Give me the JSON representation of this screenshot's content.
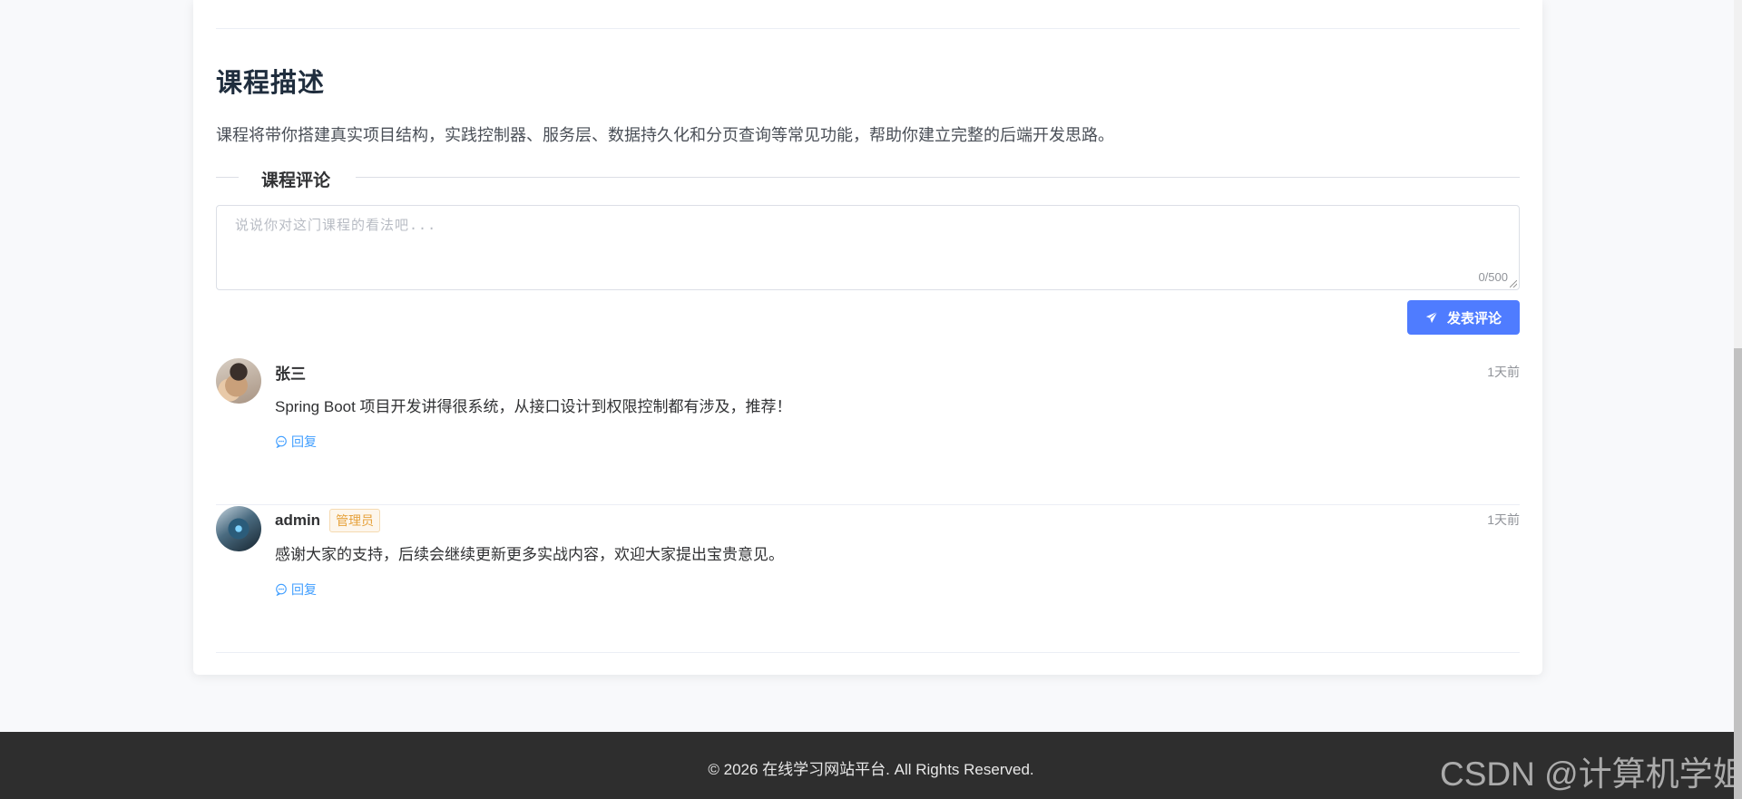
{
  "course": {
    "description_title": "课程描述",
    "description_text": "课程将带你搭建真实项目结构，实践控制器、服务层、数据持久化和分页查询等常见功能，帮助你建立完整的后端开发思路。"
  },
  "comments_section": {
    "title": "课程评论",
    "input_placeholder": "说说你对这门课程的看法吧...",
    "input_value": "",
    "char_count": "0/500",
    "submit_label": "发表评论",
    "submit_icon": "paper-plane-icon"
  },
  "comments": [
    {
      "author": "张三",
      "badge": "",
      "time": "1天前",
      "content": "Spring Boot 项目开发讲得很系统，从接口设计到权限控制都有涉及，推荐！",
      "reply_label": "回复"
    },
    {
      "author": "admin",
      "badge": "管理员",
      "time": "1天前",
      "content": "感谢大家的支持，后续会继续更新更多实战内容，欢迎大家提出宝贵意见。",
      "reply_label": "回复"
    }
  ],
  "footer": {
    "copyright": "© 2026 在线学习网站平台. All Rights Reserved."
  },
  "watermark": "CSDN @计算机学姐",
  "colors": {
    "primary": "#4f7cff",
    "link": "#409eff",
    "admin_badge": "#e6a23c",
    "footer_bg": "#2e2e2e"
  }
}
